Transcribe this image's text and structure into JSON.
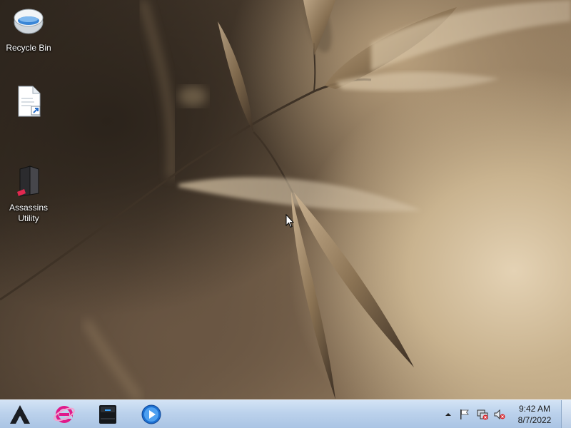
{
  "desktop": {
    "icons": [
      {
        "label": "Recycle Bin",
        "icon": "recycle-bin-icon"
      },
      {
        "label": "",
        "icon": "shortcut-file-icon"
      },
      {
        "label": "Assassins Utility",
        "icon": "assassins-utility-icon"
      }
    ]
  },
  "taskbar": {
    "start_icon": "start-logo-icon",
    "pinned": [
      {
        "name": "internet-explorer",
        "icon": "ie-icon"
      },
      {
        "name": "drive",
        "icon": "drive-icon"
      },
      {
        "name": "media-player",
        "icon": "media-player-icon"
      }
    ],
    "tray": {
      "icons": [
        "show-hidden-icons-chevron",
        "action-center-flag-icon",
        "network-icon",
        "volume-muted-icon"
      ]
    },
    "clock": {
      "time": "9:42 AM",
      "date": "8/7/2022"
    }
  },
  "colors": {
    "taskbar_top": "#d3e3f5",
    "taskbar_bottom": "#aac4e4",
    "ie_accent": "#e0198a",
    "media_player_blue": "#1c6fd0"
  }
}
